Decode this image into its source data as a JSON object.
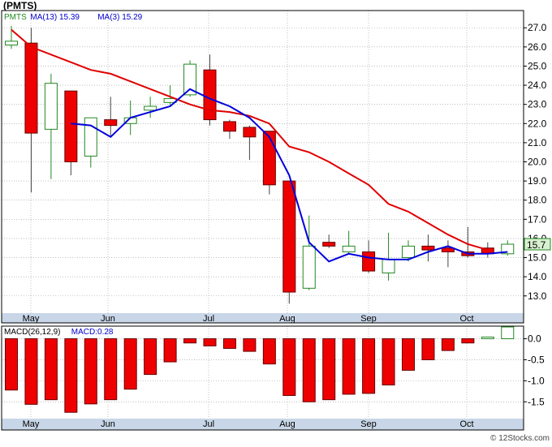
{
  "colors": {
    "price_ma13": "#e00000",
    "price_ma3": "#0000dd",
    "candle_down": "#ee0000",
    "candle_up_border": "#228822",
    "macd_bar": "#ee0000",
    "macd_pos_border": "#228822",
    "axis_band": "#c8d6e8",
    "last_price_box": "#d8f0d0",
    "grid": "#999999"
  },
  "chart_data": [
    {
      "type": "candlestick",
      "ticker": "(PMTS)",
      "legend": [
        {
          "label": "PMTS",
          "color": "#228822"
        },
        {
          "label": "MA(13)",
          "value": "15.39",
          "color": "#0000cc"
        },
        {
          "label": "MA(3)",
          "value": "15.29",
          "color": "#0000cc"
        }
      ],
      "last_price_label": "15.7",
      "ylim": [
        12.1,
        27.9
      ],
      "y_ticks": [
        "27.0",
        "26.0",
        "25.0",
        "24.0",
        "23.0",
        "22.0",
        "21.0",
        "20.0",
        "19.0",
        "18.0",
        "17.0",
        "16.0",
        "15.0",
        "14.0",
        "13.0"
      ],
      "x_labels": [
        "May",
        "Jun",
        "Jul",
        "Aug",
        "Sep",
        "Oct"
      ],
      "grid": true,
      "candles": [
        {
          "o": 26.1,
          "h": 27.1,
          "l": 25.9,
          "c": 26.3
        },
        {
          "o": 26.2,
          "h": 27.0,
          "l": 18.4,
          "c": 21.5
        },
        {
          "o": 21.7,
          "h": 24.6,
          "l": 19.1,
          "c": 24.1
        },
        {
          "o": 23.7,
          "h": 23.7,
          "l": 19.3,
          "c": 20.0
        },
        {
          "o": 20.3,
          "h": 22.3,
          "l": 19.7,
          "c": 22.3
        },
        {
          "o": 22.2,
          "h": 23.4,
          "l": 21.3,
          "c": 21.9
        },
        {
          "o": 22.0,
          "h": 23.2,
          "l": 21.4,
          "c": 22.3
        },
        {
          "o": 22.7,
          "h": 23.4,
          "l": 22.3,
          "c": 22.9
        },
        {
          "o": 23.1,
          "h": 24.0,
          "l": 22.9,
          "c": 23.3
        },
        {
          "o": 23.5,
          "h": 25.3,
          "l": 23.4,
          "c": 25.1
        },
        {
          "o": 24.8,
          "h": 25.6,
          "l": 21.9,
          "c": 22.2
        },
        {
          "o": 22.1,
          "h": 22.2,
          "l": 21.2,
          "c": 21.6
        },
        {
          "o": 21.8,
          "h": 21.9,
          "l": 20.1,
          "c": 21.3
        },
        {
          "o": 21.6,
          "h": 21.6,
          "l": 18.3,
          "c": 18.8
        },
        {
          "o": 19.0,
          "h": 19.0,
          "l": 12.6,
          "c": 13.2
        },
        {
          "o": 13.4,
          "h": 17.2,
          "l": 13.3,
          "c": 15.6
        },
        {
          "o": 15.8,
          "h": 16.2,
          "l": 15.5,
          "c": 15.6
        },
        {
          "o": 15.3,
          "h": 16.4,
          "l": 15.2,
          "c": 15.6
        },
        {
          "o": 15.3,
          "h": 15.9,
          "l": 14.2,
          "c": 14.3
        },
        {
          "o": 14.2,
          "h": 16.3,
          "l": 13.8,
          "c": 14.9
        },
        {
          "o": 15.0,
          "h": 15.9,
          "l": 14.8,
          "c": 15.6
        },
        {
          "o": 15.6,
          "h": 16.2,
          "l": 14.8,
          "c": 15.4
        },
        {
          "o": 15.5,
          "h": 15.9,
          "l": 14.5,
          "c": 15.3
        },
        {
          "o": 15.3,
          "h": 16.6,
          "l": 15.0,
          "c": 15.1
        },
        {
          "o": 15.5,
          "h": 15.8,
          "l": 15.0,
          "c": 15.2
        },
        {
          "o": 15.2,
          "h": 15.9,
          "l": 15.1,
          "c": 15.7
        }
      ],
      "ma13": [
        26.9,
        26.0,
        25.6,
        25.2,
        24.8,
        24.6,
        24.2,
        23.8,
        23.4,
        23.0,
        22.7,
        22.6,
        22.4,
        22.0,
        20.8,
        20.5,
        20.0,
        19.4,
        18.8,
        17.8,
        17.4,
        16.8,
        16.2,
        15.7,
        15.4
      ],
      "ma13_start_index": 0,
      "ma3": [
        22.0,
        21.9,
        21.3,
        22.3,
        22.6,
        22.9,
        23.8,
        23.3,
        22.9,
        22.3,
        21.3,
        19.3,
        15.8,
        14.8,
        15.2,
        15.0,
        14.9,
        14.9,
        15.3,
        15.6,
        15.2,
        15.2,
        15.3
      ],
      "ma3_start_index": 3
    },
    {
      "type": "bar",
      "legend": [
        {
          "label": "MACD(26,12,9)",
          "color": "#000000"
        },
        {
          "label": "MACD:0.28",
          "color": "#0000cc"
        }
      ],
      "ylim": [
        -1.9,
        0.3
      ],
      "y_ticks": [
        "0.0",
        "-0.5",
        "-1.0",
        "-1.5"
      ],
      "x_labels": [
        "May",
        "Jun",
        "Jul",
        "Aug",
        "Sep",
        "Oct"
      ],
      "values": [
        -1.22,
        -1.56,
        -1.45,
        -1.75,
        -1.55,
        -1.45,
        -1.2,
        -0.85,
        -0.55,
        -0.1,
        -0.17,
        -0.23,
        -0.3,
        -0.6,
        -1.35,
        -1.5,
        -1.45,
        -1.32,
        -1.3,
        -1.1,
        -0.75,
        -0.5,
        -0.28,
        -0.1,
        0.04,
        0.28
      ]
    }
  ],
  "watermark": "© 12Stocks.com"
}
